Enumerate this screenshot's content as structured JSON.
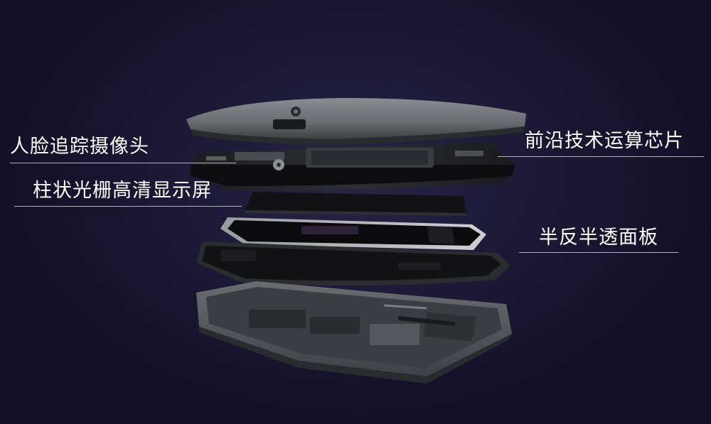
{
  "callouts": {
    "camera": "人脸追踪摄像头",
    "display": "柱状光栅高清显示屏",
    "chip": "前沿技术运算芯片",
    "panel": "半反半透面板"
  },
  "colors": {
    "background": "#1b1733",
    "label_text": "#ffffff",
    "shell": "#5c5e63",
    "dark_layer": "#111114"
  }
}
